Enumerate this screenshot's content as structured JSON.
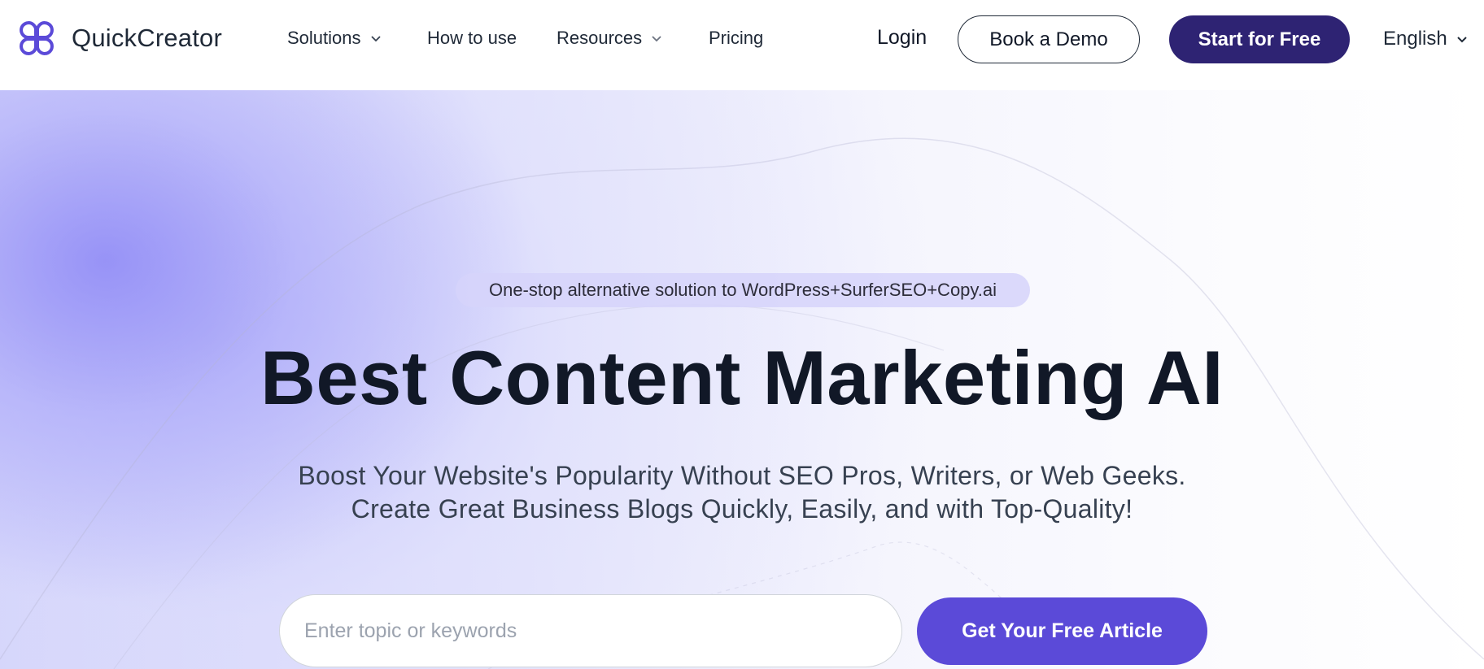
{
  "brand": {
    "name": "QuickCreator",
    "logo_icon": "clover-logo-icon",
    "accent": "#5b4ad8"
  },
  "nav": {
    "items": [
      {
        "label": "Solutions",
        "has_dropdown": true
      },
      {
        "label": "How to use",
        "has_dropdown": false
      },
      {
        "label": "Resources",
        "has_dropdown": true
      },
      {
        "label": "Pricing",
        "has_dropdown": false
      }
    ],
    "login": "Login",
    "book_demo": "Book a Demo",
    "start_free": "Start for Free",
    "language": "English"
  },
  "hero": {
    "badge": "One-stop alternative solution to WordPress+SurferSEO+Copy.ai",
    "headline": "Best Content Marketing AI",
    "subline_1": "Boost Your Website's Popularity Without SEO Pros, Writers, or Web Geeks.",
    "subline_2": "Create Great Business Blogs Quickly, Easily, and with Top-Quality!",
    "search": {
      "value": "",
      "placeholder": "Enter topic or keywords"
    },
    "cta": "Get Your Free Article"
  },
  "colors": {
    "primary_dark": "#2e2373",
    "cta": "#5b4ad8",
    "badge_bg": "#d6d4fa",
    "text": "#111827"
  }
}
